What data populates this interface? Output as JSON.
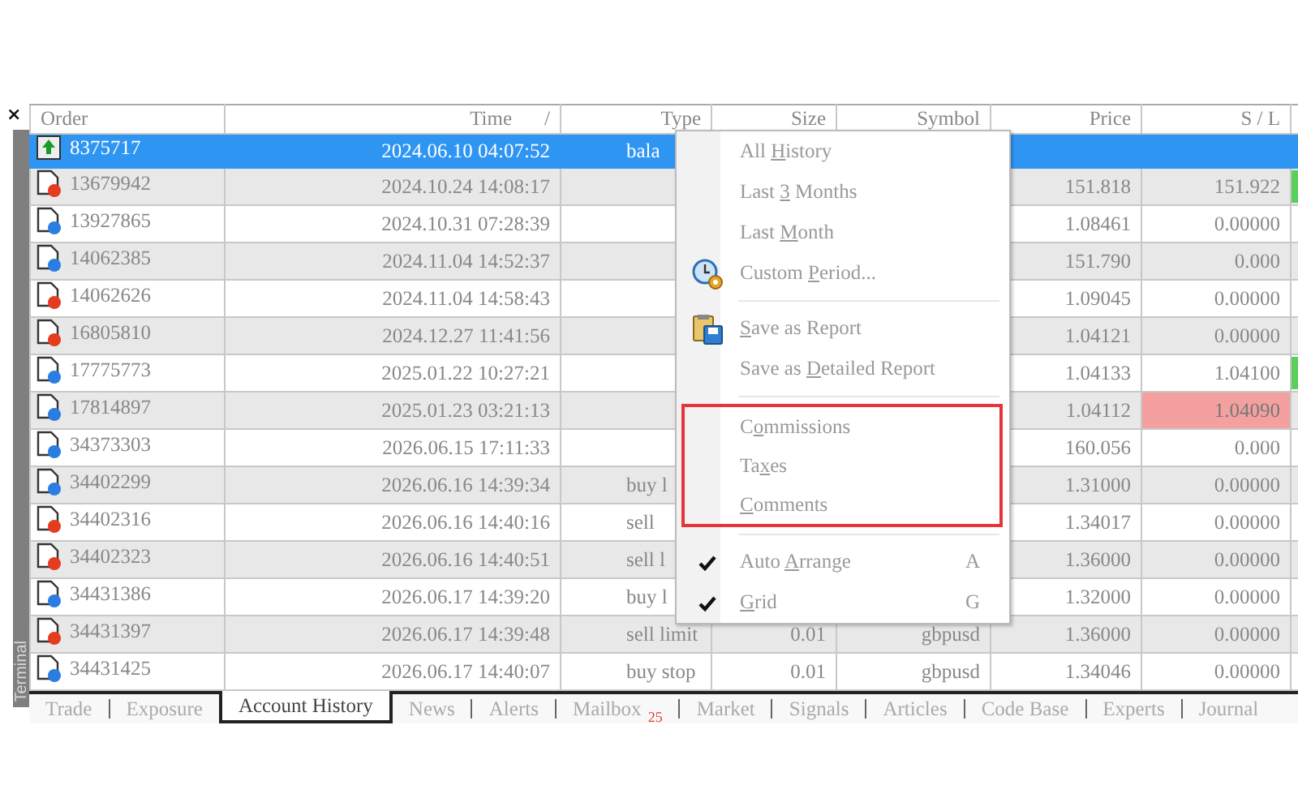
{
  "close_button": "×",
  "sidebar": {
    "title": "Terminal"
  },
  "table": {
    "columns": [
      {
        "label": "Order"
      },
      {
        "label": "Time",
        "sort_mark": "/"
      },
      {
        "label": "Type"
      },
      {
        "label": "Size"
      },
      {
        "label": "Symbol"
      },
      {
        "label": "Price"
      },
      {
        "label": "S / L"
      }
    ],
    "rows": [
      {
        "kind": "balance",
        "order": "8375717",
        "time": "2024.06.10 04:07:52",
        "type": "bala",
        "selected": true,
        "sl_hit": false,
        "tp_hit": false
      },
      {
        "kind": "sell",
        "order": "13679942",
        "time": "2024.10.24 14:08:17",
        "price": "151.818",
        "sl": "151.922",
        "selected": false,
        "sl_hit": false,
        "tp_hit": true
      },
      {
        "kind": "buy",
        "order": "13927865",
        "time": "2024.10.31 07:28:39",
        "price": "1.08461",
        "sl": "0.00000",
        "selected": false,
        "sl_hit": false,
        "tp_hit": false
      },
      {
        "kind": "buy",
        "order": "14062385",
        "time": "2024.11.04 14:52:37",
        "price": "151.790",
        "sl": "0.000",
        "selected": false,
        "sl_hit": false,
        "tp_hit": false
      },
      {
        "kind": "sell",
        "order": "14062626",
        "time": "2024.11.04 14:58:43",
        "price": "1.09045",
        "sl": "0.00000",
        "selected": false,
        "sl_hit": false,
        "tp_hit": false
      },
      {
        "kind": "sell",
        "order": "16805810",
        "time": "2024.12.27 11:41:56",
        "price": "1.04121",
        "sl": "0.00000",
        "selected": false,
        "sl_hit": false,
        "tp_hit": false
      },
      {
        "kind": "buy",
        "order": "17775773",
        "time": "2025.01.22 10:27:21",
        "price": "1.04133",
        "sl": "1.04100",
        "selected": false,
        "sl_hit": false,
        "tp_hit": true
      },
      {
        "kind": "buy",
        "order": "17814897",
        "time": "2025.01.23 03:21:13",
        "price": "1.04112",
        "sl": "1.04090",
        "selected": false,
        "sl_hit": true,
        "tp_hit": false
      },
      {
        "kind": "buy",
        "order": "34373303",
        "time": "2026.06.15 17:11:33",
        "price": "160.056",
        "sl": "0.000",
        "selected": false,
        "sl_hit": false,
        "tp_hit": false
      },
      {
        "kind": "buy",
        "order": "34402299",
        "time": "2026.06.16 14:39:34",
        "type": "buy l",
        "price": "1.31000",
        "sl": "0.00000",
        "selected": false,
        "sl_hit": false,
        "tp_hit": false
      },
      {
        "kind": "sell",
        "order": "34402316",
        "time": "2026.06.16 14:40:16",
        "type": "sell",
        "price": "1.34017",
        "sl": "0.00000",
        "selected": false,
        "sl_hit": false,
        "tp_hit": false
      },
      {
        "kind": "sell",
        "order": "34402323",
        "time": "2026.06.16 14:40:51",
        "type": "sell l",
        "price": "1.36000",
        "sl": "0.00000",
        "selected": false,
        "sl_hit": false,
        "tp_hit": false
      },
      {
        "kind": "buy",
        "order": "34431386",
        "time": "2026.06.17 14:39:20",
        "type": "buy l",
        "price": "1.32000",
        "sl": "0.00000",
        "selected": false,
        "sl_hit": false,
        "tp_hit": false
      },
      {
        "kind": "sell",
        "order": "34431397",
        "time": "2026.06.17 14:39:48",
        "type": "sell limit",
        "size": "0.01",
        "symbol": "gbpusd",
        "price": "1.36000",
        "sl": "0.00000",
        "selected": false,
        "sl_hit": false,
        "tp_hit": false
      },
      {
        "kind": "buy",
        "order": "34431425",
        "time": "2026.06.17 14:40:07",
        "type": "buy stop",
        "size": "0.01",
        "symbol": "gbpusd",
        "price": "1.34046",
        "sl": "0.00000",
        "selected": false,
        "sl_hit": false,
        "tp_hit": false
      }
    ]
  },
  "context_menu": {
    "sections": [
      {
        "highlighted": false,
        "items": [
          {
            "label": {
              "before": "All ",
              "key": "H",
              "after": "istory"
            },
            "checked": false
          },
          {
            "label": {
              "before": "Last ",
              "key": "3",
              "after": " Months"
            },
            "checked": false
          },
          {
            "label": {
              "before": "Last ",
              "key": "M",
              "after": "onth"
            },
            "checked": false
          },
          {
            "label": {
              "before": "Custom ",
              "key": "P",
              "after": "eriod..."
            },
            "checked": false
          }
        ]
      },
      {
        "highlighted": false,
        "items": [
          {
            "label": {
              "key": "S",
              "after": "ave as Report"
            },
            "checked": false
          },
          {
            "label": {
              "before": "Save as ",
              "key": "D",
              "after": "etailed Report"
            },
            "checked": false
          }
        ]
      },
      {
        "highlighted": true,
        "items": [
          {
            "label": {
              "before": "C",
              "key": "o",
              "after": "mmissions"
            },
            "checked": false
          },
          {
            "label": {
              "before": "Ta",
              "key": "x",
              "after": "es"
            },
            "checked": false
          },
          {
            "label": {
              "key": "C",
              "after": "omments"
            },
            "checked": false
          }
        ]
      },
      {
        "highlighted": false,
        "items": [
          {
            "label": {
              "before": "Auto ",
              "key": "A",
              "after": "rrange"
            },
            "shortcut": "A",
            "checked": true
          },
          {
            "label": {
              "key": "G",
              "after": "rid"
            },
            "shortcut": "G",
            "checked": true
          }
        ]
      }
    ]
  },
  "tabs": [
    {
      "label": "Trade",
      "selected": false
    },
    {
      "label": "Exposure",
      "selected": false
    },
    {
      "label": "Account History",
      "selected": true
    },
    {
      "label": "News",
      "selected": false
    },
    {
      "label": "Alerts",
      "selected": false
    },
    {
      "label": "Mailbox",
      "badge": "25",
      "selected": false
    },
    {
      "label": "Market",
      "selected": false
    },
    {
      "label": "Signals",
      "selected": false
    },
    {
      "label": "Articles",
      "selected": false
    },
    {
      "label": "Code Base",
      "selected": false
    },
    {
      "label": "Experts",
      "selected": false
    },
    {
      "label": "Journal",
      "selected": false
    }
  ]
}
